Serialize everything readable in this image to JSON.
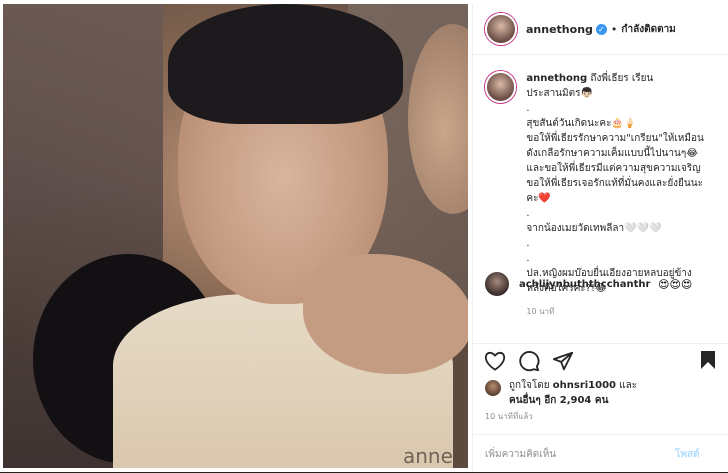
{
  "post": {
    "username": "annethong",
    "verified_mark": "✓",
    "separator": "•",
    "follow_status": "กำลังติดตาม",
    "caption": {
      "username": "annethong",
      "lines": [
        "ถึงพี่เธียร เรียน",
        "ประสานมิตร👦🏻",
        ".",
        "สุขสันต์วันเกิดนะคะ🎂🍦",
        "ขอให้พี่เธียรรักษาความ\"เกรียน\"ให้เหมือน",
        "ดังเกลือรักษาความเค็มแบบนี้ไปนานๆ😂",
        "และขอให้พี่เธียรมีแต่ความสุขความเจริญ",
        "ขอให้พี่เธียรเจอรักแท้ที่มั่นคงและยั่งยืนนะ",
        "คะ❤️",
        ".",
        "จากน้องเมยวัดเทพลีลา🤍🤍🤍",
        ".",
        ".",
        "ปล.หญิงผมบ๊อบยื่นเอียงอายหลบอยู่ข้าง",
        "หลังคือใครคะ?!😂"
      ],
      "time": "10 นาที"
    },
    "comment": {
      "username": "achlijynbuththcchanthr",
      "emoji": "😍😍😍"
    },
    "likes": {
      "prefix": "ถูกใจโดย",
      "user": "ohnsri1000",
      "and": "และ",
      "others": "คนอื่นๆ อีก 2,904 คน"
    },
    "post_time": "10 นาทีที่แล้ว",
    "comment_placeholder": "เพิ่มความคิดเห็น",
    "post_button": "โพสต์",
    "watermark": "anne"
  },
  "colors": {
    "text": "#262626",
    "muted": "#8e8e8e",
    "verified": "#3897f0",
    "post_disabled": "#b2dffc"
  },
  "icons": [
    "heart-icon",
    "comment-icon",
    "share-icon",
    "bookmark-icon",
    "verified-icon"
  ]
}
